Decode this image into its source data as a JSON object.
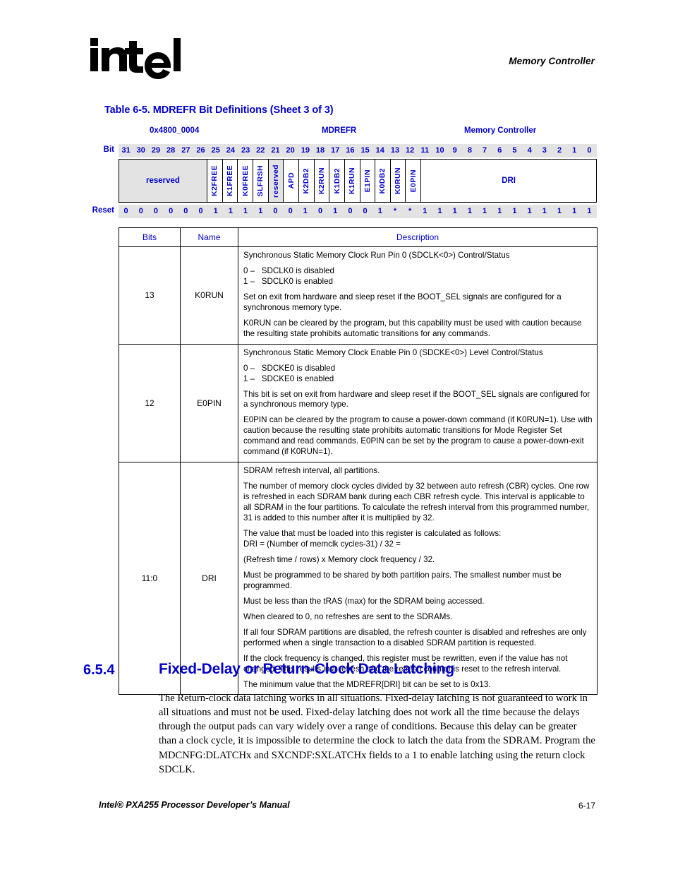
{
  "header": {
    "logo_alt": "intel",
    "logo_registered": "®",
    "chapter_title": "Memory Controller"
  },
  "table": {
    "caption": "Table 6-5. MDREFR Bit Definitions (Sheet 3 of 3)",
    "register": {
      "address": "0x4800_0004",
      "name": "MDREFR",
      "unit": "Memory Controller"
    },
    "bit_row_label": "Bit",
    "reset_row_label": "Reset",
    "bit_numbers": [
      "31",
      "30",
      "29",
      "28",
      "27",
      "26",
      "25",
      "24",
      "23",
      "22",
      "21",
      "20",
      "19",
      "18",
      "17",
      "16",
      "15",
      "14",
      "13",
      "12",
      "11",
      "10",
      "9",
      "8",
      "7",
      "6",
      "5",
      "4",
      "3",
      "2",
      "1",
      "0"
    ],
    "reset_values": [
      "0",
      "0",
      "0",
      "0",
      "0",
      "0",
      "1",
      "1",
      "1",
      "1",
      "0",
      "0",
      "1",
      "0",
      "1",
      "0",
      "0",
      "1",
      "*",
      "*",
      "1",
      "1",
      "1",
      "1",
      "1",
      "1",
      "1",
      "1",
      "1",
      "1",
      "1",
      "1"
    ],
    "fields": [
      {
        "label": "reserved",
        "bits": 6,
        "style": "gray",
        "orient": "horizontal"
      },
      {
        "label": "K2FREE",
        "bits": 1,
        "style": "plain",
        "orient": "vertical"
      },
      {
        "label": "K1FREE",
        "bits": 1,
        "style": "plain",
        "orient": "vertical"
      },
      {
        "label": "K0FREE",
        "bits": 1,
        "style": "plain",
        "orient": "vertical"
      },
      {
        "label": "SLFRSH",
        "bits": 1,
        "style": "plain",
        "orient": "vertical"
      },
      {
        "label": "reserved",
        "bits": 1,
        "style": "gray",
        "orient": "vertical"
      },
      {
        "label": "APD",
        "bits": 1,
        "style": "plain",
        "orient": "vertical"
      },
      {
        "label": "K2DB2",
        "bits": 1,
        "style": "plain",
        "orient": "vertical"
      },
      {
        "label": "K2RUN",
        "bits": 1,
        "style": "plain",
        "orient": "vertical"
      },
      {
        "label": "K1DB2",
        "bits": 1,
        "style": "plain",
        "orient": "vertical"
      },
      {
        "label": "K1RUN",
        "bits": 1,
        "style": "plain",
        "orient": "vertical"
      },
      {
        "label": "E1PIN",
        "bits": 1,
        "style": "plain",
        "orient": "vertical"
      },
      {
        "label": "K0DB2",
        "bits": 1,
        "style": "plain",
        "orient": "vertical"
      },
      {
        "label": "K0RUN",
        "bits": 1,
        "style": "plain",
        "orient": "vertical"
      },
      {
        "label": "E0PIN",
        "bits": 1,
        "style": "plain",
        "orient": "vertical"
      },
      {
        "label": "DRI",
        "bits": 12,
        "style": "plain",
        "orient": "horizontal"
      }
    ],
    "columns": {
      "bits": "Bits",
      "name": "Name",
      "description": "Description"
    },
    "rows": [
      {
        "bits": "13",
        "name": "K0RUN",
        "description": [
          {
            "type": "p",
            "text": "Synchronous Static Memory Clock Run Pin 0 (SDCLK<0>) Control/Status"
          },
          {
            "type": "list",
            "items": [
              "0 –   SDCLK0 is disabled",
              "1 –   SDCLK0 is enabled"
            ]
          },
          {
            "type": "p",
            "text": "Set on exit from hardware and sleep reset if the BOOT_SEL signals are configured for a synchronous memory type."
          },
          {
            "type": "p",
            "text": "K0RUN can be cleared by the program, but this capability must be used with caution because the resulting state prohibits automatic transitions for any commands."
          }
        ]
      },
      {
        "bits": "12",
        "name": "E0PIN",
        "description": [
          {
            "type": "p",
            "text": "Synchronous Static Memory Clock Enable Pin 0 (SDCKE<0>) Level Control/Status"
          },
          {
            "type": "list",
            "items": [
              "0 –   SDCKE0 is disabled",
              "1 –   SDCKE0 is enabled"
            ]
          },
          {
            "type": "p",
            "text": "This bit is set on exit from hardware and sleep reset if the BOOT_SEL signals are configured for a synchronous memory type."
          },
          {
            "type": "p",
            "text": "E0PIN can be cleared by the program to cause a power-down command (if K0RUN=1). Use with caution because the resulting state prohibits automatic transitions for Mode Register Set command and read commands. E0PIN can be set by the program to cause a power-down-exit command (if K0RUN=1)."
          }
        ]
      },
      {
        "bits": "11:0",
        "name": "DRI",
        "description": [
          {
            "type": "p",
            "text": "SDRAM refresh interval, all partitions."
          },
          {
            "type": "p",
            "text": "The number of memory clock cycles divided by 32 between auto refresh (CBR) cycles. One row is refreshed in each SDRAM bank during each CBR refresh cycle. This interval is applicable to all SDRAM in the four partitions. To calculate the refresh interval from this programmed number, 31 is added to this number after it is multiplied by 32."
          },
          {
            "type": "list",
            "items": [
              "The value that must be loaded into this register is calculated as follows:",
              "DRI = (Number of memclk cycles-31) / 32 ="
            ]
          },
          {
            "type": "p",
            "text": "(Refresh time / rows) x Memory clock frequency / 32."
          },
          {
            "type": "p",
            "text": "Must be programmed to be shared by both partition pairs. The smallest number must be programmed."
          },
          {
            "type": "p",
            "text": "Must be less than the tRAS (max) for the SDRAM being accessed."
          },
          {
            "type": "p",
            "text": "When cleared to 0, no refreshes are sent to the SDRAMs."
          },
          {
            "type": "p",
            "text": "If all four SDRAM partitions are disabled, the refresh counter is disabled and refreshes are only performed when a single transaction to a disabled SDRAM partition is requested."
          },
          {
            "type": "p",
            "text": "If the clock frequency is changed, this register must be rewritten, even if the value has not changed. This results in a refresh and the refresh counter is reset to the refresh interval."
          },
          {
            "type": "p",
            "text": "The minimum value that the MDREFR[DRI] bit can be set to is 0x13."
          }
        ]
      }
    ]
  },
  "section": {
    "number": "6.5.4",
    "title": "Fixed-Delay or Return-Clock Data Latching",
    "paragraph": "The Return-clock data latching works in all situations. Fixed-delay latching is not guaranteed to work in all situations and must not be used. Fixed-delay latching does not work all the time because the delays through the output pads can vary widely over a range of conditions. Because this delay can be greater than a clock cycle, it is impossible to determine the clock to latch the data from the SDRAM. Program the MDCNFG:DLATCHx and SXCNDF:SXLATCHx fields to a 1 to enable latching using the return clock SDCLK."
  },
  "footer": {
    "manual": "Intel® PXA255 Processor Developer’s Manual",
    "page": "6-17"
  },
  "colors": {
    "accent_blue": "#0000CC",
    "band_gray": "#e3e3e3",
    "text": "#000000"
  }
}
